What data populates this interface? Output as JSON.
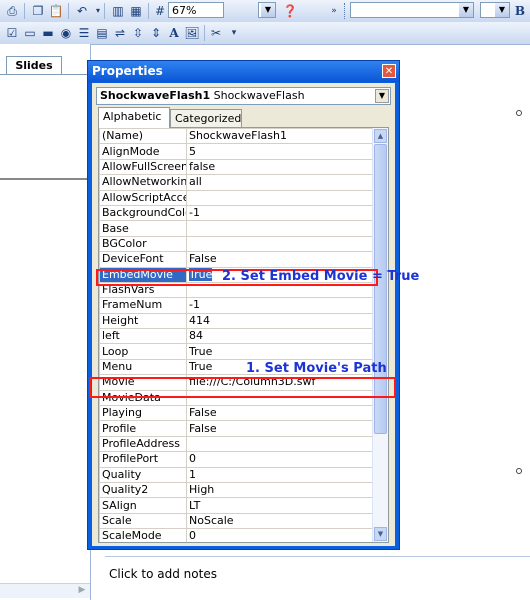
{
  "toolbar": {
    "zoom": "67%",
    "font_b": "B"
  },
  "left_pane": {
    "slides_tab": "Slides"
  },
  "properties": {
    "title": "Properties",
    "object_name": "ShockwaveFlash1",
    "object_type": "ShockwaveFlash",
    "tabs": [
      "Alphabetic",
      "Categorized"
    ],
    "rows": [
      {
        "name": "(Name)",
        "value": "ShockwaveFlash1"
      },
      {
        "name": "AlignMode",
        "value": "5"
      },
      {
        "name": "AllowFullScreen",
        "value": "false"
      },
      {
        "name": "AllowNetworking",
        "value": "all"
      },
      {
        "name": "AllowScriptAccess",
        "value": ""
      },
      {
        "name": "BackgroundColor",
        "value": "-1"
      },
      {
        "name": "Base",
        "value": ""
      },
      {
        "name": "BGColor",
        "value": ""
      },
      {
        "name": "DeviceFont",
        "value": "False"
      },
      {
        "name": "EmbedMovie",
        "value": "True"
      },
      {
        "name": "FlashVars",
        "value": ""
      },
      {
        "name": "FrameNum",
        "value": "-1"
      },
      {
        "name": "Height",
        "value": "414"
      },
      {
        "name": "left",
        "value": "84"
      },
      {
        "name": "Loop",
        "value": "True"
      },
      {
        "name": "Menu",
        "value": "True"
      },
      {
        "name": "Movie",
        "value": "file:///C:/Column3D.swf"
      },
      {
        "name": "MovieData",
        "value": ""
      },
      {
        "name": "Playing",
        "value": "False"
      },
      {
        "name": "Profile",
        "value": "False"
      },
      {
        "name": "ProfileAddress",
        "value": ""
      },
      {
        "name": "ProfilePort",
        "value": "0"
      },
      {
        "name": "Quality",
        "value": "1"
      },
      {
        "name": "Quality2",
        "value": "High"
      },
      {
        "name": "SAlign",
        "value": "LT"
      },
      {
        "name": "Scale",
        "value": "NoScale"
      },
      {
        "name": "ScaleMode",
        "value": "0"
      }
    ]
  },
  "annotations": {
    "embed": "2. Set Embed Movie = True",
    "movie": "1. Set Movie's Path"
  },
  "notes": {
    "placeholder": "Click to add notes"
  },
  "colors": {
    "annotation_text": "#1c34d6",
    "highlight": "#ff1a1a",
    "title_bar": "#0b55d6"
  }
}
